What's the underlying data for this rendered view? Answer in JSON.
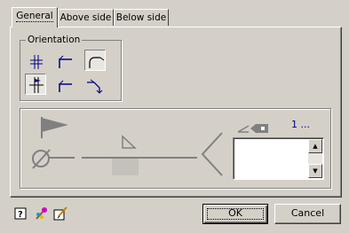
{
  "tabs": [
    {
      "label": "General",
      "active": true
    },
    {
      "label": "Above side",
      "active": false
    },
    {
      "label": "Below side",
      "active": false
    }
  ],
  "orientation": {
    "label": "Orientation",
    "options": [
      {
        "icon": "vertical-crossed-weld-icon",
        "selected": false
      },
      {
        "icon": "leader-corner-left-icon",
        "selected": false
      },
      {
        "icon": "leader-curve-icon",
        "selected": true
      },
      {
        "icon": "vertical-crossed-weld-flag-icon",
        "selected": true
      },
      {
        "icon": "leader-corner-left-alt-icon",
        "selected": false
      },
      {
        "icon": "leader-tail-arrow-icon",
        "selected": false
      }
    ]
  },
  "preview": {
    "counter_text": "1 ...",
    "icons": [
      "flag-icon",
      "circle-cross-icon",
      "triangle-icon",
      "tail-icon",
      "tag-icon"
    ]
  },
  "buttons": {
    "ok_label": "OK",
    "cancel_label": "Cancel"
  },
  "bottom_icons": [
    "help-icon",
    "paint-icon",
    "edit-icon"
  ],
  "colors": {
    "face": "#d4d0c8",
    "preview_line": "#808080",
    "counter": "#000080"
  }
}
